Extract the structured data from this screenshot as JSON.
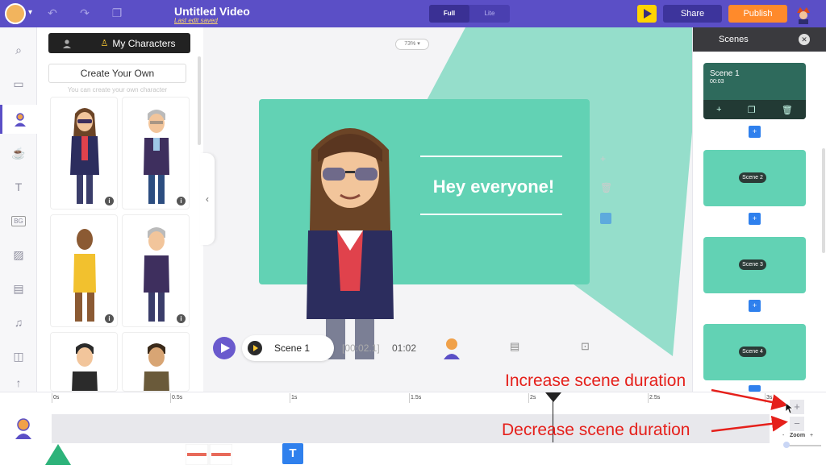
{
  "topbar": {
    "title": "Untitled Video",
    "subtitle": "Last edit saved",
    "modes": [
      "Full",
      "Lite"
    ],
    "active_mode": "Full",
    "share_label": "Share",
    "publish_label": "Publish",
    "icons": [
      "undo-icon",
      "redo-icon",
      "duplicate-icon",
      "preview-play-icon"
    ]
  },
  "leftnav": {
    "items": [
      "search-icon",
      "scene-icon",
      "characters-icon",
      "props-icon",
      "text-icon",
      "bg-icon",
      "image-icon",
      "video-icon",
      "music-icon",
      "effects-icon",
      "upload-icon"
    ],
    "bg_label": "BG",
    "active": "characters-icon"
  },
  "panel": {
    "tab_mine": "My Characters",
    "create_label": "Create Your Own",
    "create_hint": "You can create your own character"
  },
  "stage": {
    "zoom": "73%",
    "headline": "Hey everyone!",
    "scene_label": "Scene 1",
    "time_current": "[00:02.1]",
    "time_total": "01:02"
  },
  "scenes": {
    "title": "Scenes",
    "items": [
      {
        "name": "Scene 1",
        "duration": "00:03"
      },
      {
        "name": "Scene 2"
      },
      {
        "name": "Scene 3"
      },
      {
        "name": "Scene 4"
      }
    ]
  },
  "timeline": {
    "ticks": [
      "0s",
      "0.5s",
      "1s",
      "1.5s",
      "2s",
      "2.5s",
      "3s"
    ],
    "zoom_label": "Zoom",
    "zoom_minus": "-",
    "zoom_plus": "+"
  },
  "annotations": {
    "increase": "Increase scene duration",
    "decrease": "Decrease scene duration"
  },
  "colors": {
    "brand": "#5b4fc6",
    "publish": "#ff8a2b",
    "scene_teal": "#62d2b4",
    "annotation_red": "#e5201b"
  }
}
